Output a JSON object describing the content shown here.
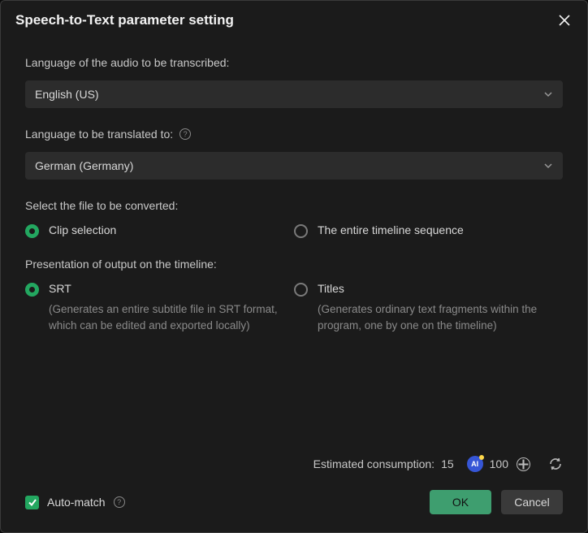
{
  "title": "Speech-to-Text parameter setting",
  "labels": {
    "source_lang": "Language of the audio to be transcribed:",
    "target_lang": "Language to be translated to:",
    "file_select": "Select the file to be converted:",
    "output_pres": "Presentation of output on the timeline:"
  },
  "selects": {
    "source_lang_value": "English (US)",
    "target_lang_value": "German (Germany)"
  },
  "file_options": {
    "clip": "Clip selection",
    "timeline": "The entire timeline sequence"
  },
  "output_options": {
    "srt": "SRT",
    "srt_desc": "(Generates an entire subtitle file in SRT format, which can be edited and exported locally)",
    "titles": "Titles",
    "titles_desc": "(Generates ordinary text fragments within the program, one by one on the timeline)"
  },
  "footer": {
    "est_label": "Estimated consumption:",
    "est_value": "15",
    "credits": "100",
    "ai_badge": "AI",
    "auto_match": "Auto-match"
  },
  "buttons": {
    "ok": "OK",
    "cancel": "Cancel"
  }
}
